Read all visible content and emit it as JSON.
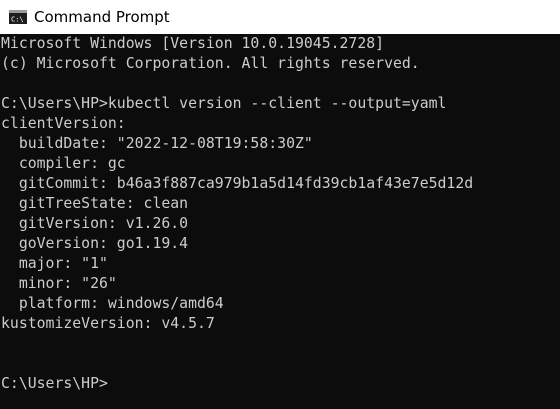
{
  "window": {
    "title": "Command Prompt",
    "icon": "cmd-icon"
  },
  "console": {
    "lines": [
      "Microsoft Windows [Version 10.0.19045.2728]",
      "(c) Microsoft Corporation. All rights reserved.",
      "",
      "C:\\Users\\HP>kubectl version --client --output=yaml",
      "clientVersion:",
      "  buildDate: \"2022-12-08T19:58:30Z\"",
      "  compiler: gc",
      "  gitCommit: b46a3f887ca979b1a5d14fd39cb1af43e7e5d12d",
      "  gitTreeState: clean",
      "  gitVersion: v1.26.0",
      "  goVersion: go1.19.4",
      "  major: \"1\"",
      "  minor: \"26\"",
      "  platform: windows/amd64",
      "kustomizeVersion: v4.5.7",
      "",
      "",
      "C:\\Users\\HP>"
    ]
  }
}
